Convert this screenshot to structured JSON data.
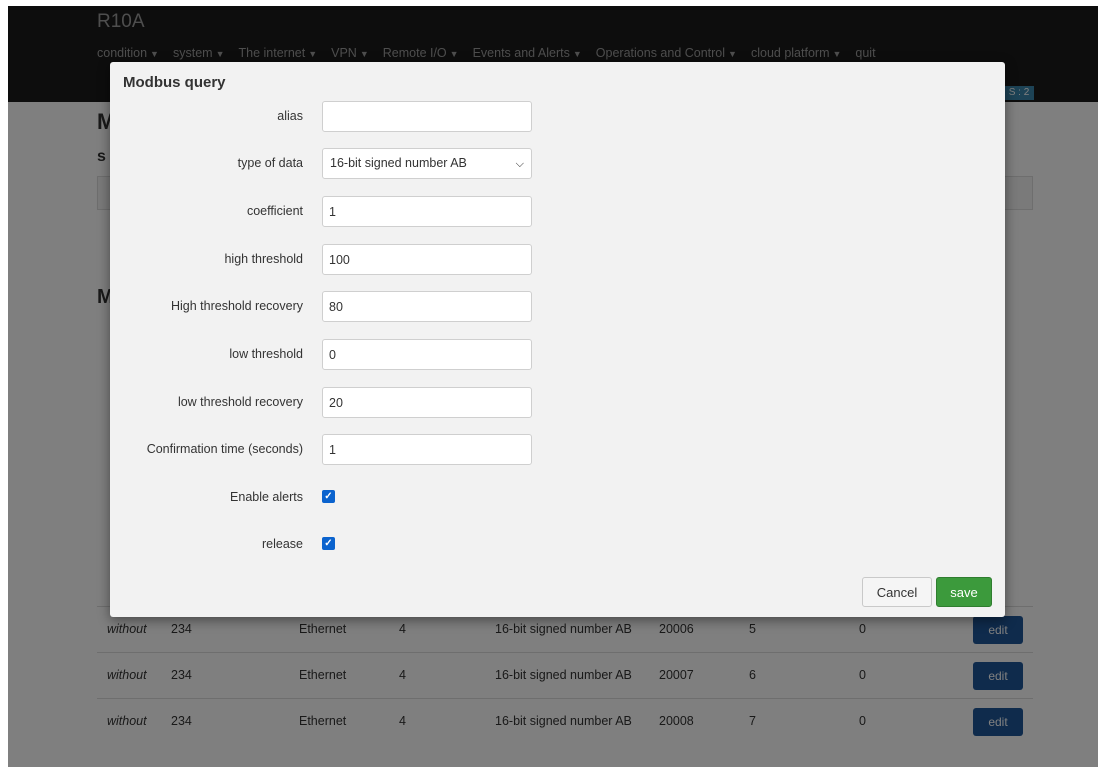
{
  "app": {
    "brand": "R10A",
    "nav": [
      {
        "label": "condition"
      },
      {
        "label": "system"
      },
      {
        "label": "The internet"
      },
      {
        "label": "VPN"
      },
      {
        "label": "Remote I/O"
      },
      {
        "label": "Events and Alerts"
      },
      {
        "label": "Operations and Control"
      },
      {
        "label": "cloud platform"
      },
      {
        "label": "quit"
      }
    ],
    "badge": "S : 2",
    "page_title_initial": "M",
    "section_initial": "s",
    "section2_initial": "M",
    "table_rows": [
      {
        "alias": "without",
        "device": "234",
        "interface": "Ethernet",
        "id": "4",
        "type": "16-bit signed number AB",
        "address": "20006",
        "index": "5",
        "value": "0",
        "edit": "edit"
      },
      {
        "alias": "without",
        "device": "234",
        "interface": "Ethernet",
        "id": "4",
        "type": "16-bit signed number AB",
        "address": "20007",
        "index": "6",
        "value": "0",
        "edit": "edit"
      },
      {
        "alias": "without",
        "device": "234",
        "interface": "Ethernet",
        "id": "4",
        "type": "16-bit signed number AB",
        "address": "20008",
        "index": "7",
        "value": "0",
        "edit": "edit"
      }
    ]
  },
  "modal": {
    "title": "Modbus query",
    "fields": {
      "alias": {
        "label": "alias",
        "value": ""
      },
      "type_of_data": {
        "label": "type of data",
        "value": "16-bit signed number AB"
      },
      "coefficient": {
        "label": "coefficient",
        "value": "1"
      },
      "high_threshold": {
        "label": "high threshold",
        "value": "100"
      },
      "high_threshold_recovery": {
        "label": "High threshold recovery",
        "value": "80"
      },
      "low_threshold": {
        "label": "low threshold",
        "value": "0"
      },
      "low_threshold_recovery": {
        "label": "low threshold recovery",
        "value": "20"
      },
      "confirmation_time": {
        "label": "Confirmation time (seconds)",
        "value": "1"
      },
      "enable_alerts": {
        "label": "Enable alerts",
        "checked": true
      },
      "release": {
        "label": "release",
        "checked": true
      }
    },
    "buttons": {
      "cancel": "Cancel",
      "save": "save"
    }
  },
  "colors": {
    "save_button": "#3c9a3c",
    "checkbox": "#0b63ce",
    "edit_button": "#1e5799",
    "topbar": "#1b1b1b"
  }
}
